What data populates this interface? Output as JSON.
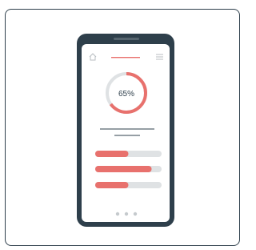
{
  "illustration": {
    "progress_label": "65%",
    "progress_value": 0.65,
    "bars": [
      {
        "fill": 0.5
      },
      {
        "fill": 0.85
      },
      {
        "fill": 0.5
      }
    ],
    "pagination_dots": 3
  },
  "colors": {
    "frame": "#2e3f4b",
    "accent": "#e8716d",
    "track": "#dfe2e4",
    "screen": "#ffffff",
    "muted": "#c5cacd"
  }
}
